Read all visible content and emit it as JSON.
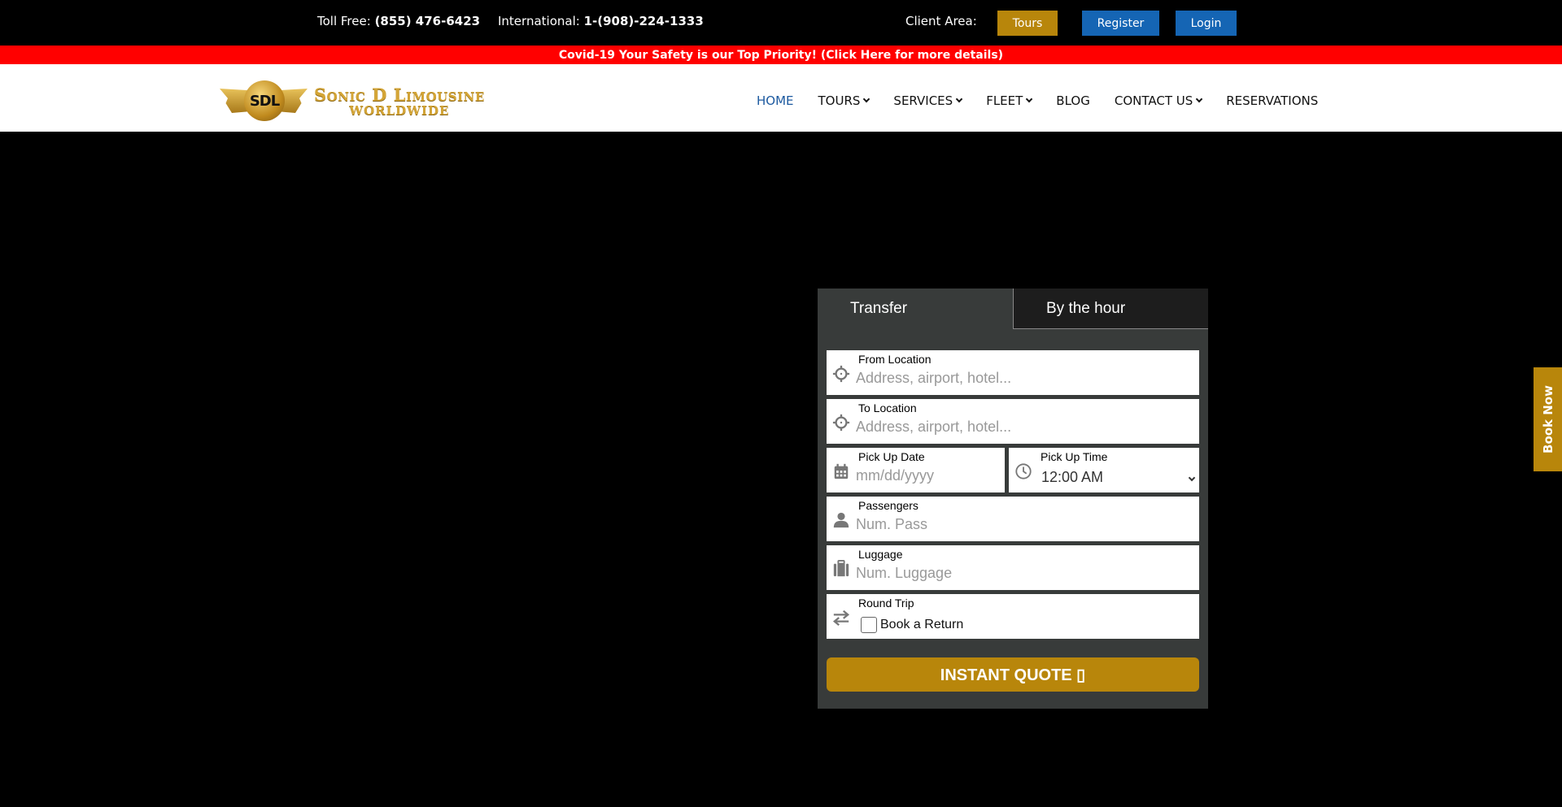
{
  "colors": {
    "gold": "#b8860b",
    "blue": "#1565b4",
    "red": "#ff0000",
    "nav_active": "#1d5aa0"
  },
  "topbar": {
    "toll_free_label": "Toll Free:",
    "toll_free_number": "(855) 476-6423",
    "international_label": "International:",
    "international_number": "1-(908)-224-1333",
    "client_area_label": "Client Area:",
    "buttons": {
      "tours": "Tours",
      "register": "Register",
      "login": "Login"
    }
  },
  "banner": {
    "text": "Covid-19 Your Safety is our Top Priority! (Click Here for more details)"
  },
  "logo": {
    "emblem": "SDL",
    "line1": "Sonic D Limousine",
    "line2": "WORLDWIDE"
  },
  "nav": {
    "items": [
      {
        "label": "HOME",
        "active": true,
        "dropdown": false
      },
      {
        "label": "TOURS",
        "dropdown": true
      },
      {
        "label": "SERVICES",
        "dropdown": true
      },
      {
        "label": "FLEET",
        "dropdown": true
      },
      {
        "label": "BLOG",
        "dropdown": false
      },
      {
        "label": "CONTACT US",
        "dropdown": true
      },
      {
        "label": "RESERVATIONS",
        "dropdown": false
      }
    ]
  },
  "booking": {
    "tabs": [
      {
        "label": "Transfer",
        "active": true
      },
      {
        "label": "By the hour",
        "active": false
      }
    ],
    "fields": {
      "from": {
        "label": "From Location",
        "placeholder": "Address, airport, hotel...",
        "icon": "crosshair-icon"
      },
      "to": {
        "label": "To Location",
        "placeholder": "Address, airport, hotel...",
        "icon": "crosshair-icon"
      },
      "date": {
        "label": "Pick Up Date",
        "placeholder": "mm/dd/yyyy",
        "icon": "calendar-icon"
      },
      "time": {
        "label": "Pick Up Time",
        "value": "12:00 AM",
        "icon": "clock-icon"
      },
      "passengers": {
        "label": "Passengers",
        "placeholder": "Num. Pass",
        "icon": "user-icon"
      },
      "luggage": {
        "label": "Luggage",
        "placeholder": "Num. Luggage",
        "icon": "suitcase-icon"
      },
      "round_trip": {
        "label": "Round Trip",
        "checkbox_label": "Book a Return",
        "checked": false,
        "icon": "exchange-icon"
      }
    },
    "submit_label": "INSTANT QUOTE ▯"
  },
  "side_tab": {
    "label": "Book Now"
  }
}
